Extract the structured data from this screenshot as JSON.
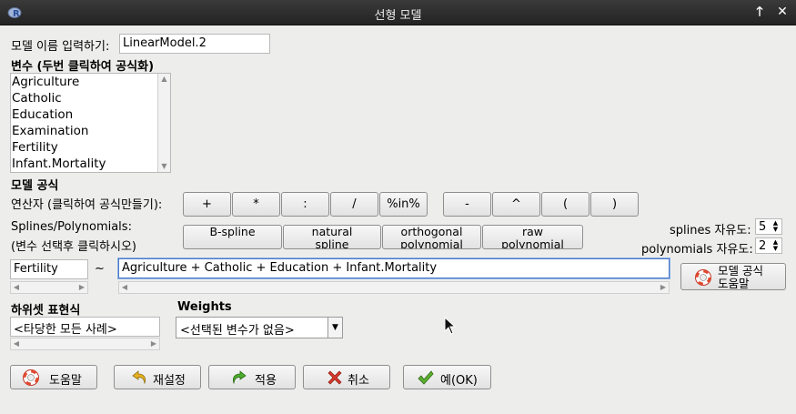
{
  "window": {
    "title": "선형 모델",
    "up_glyph": "🡑",
    "close_glyph": "✕"
  },
  "model_name": {
    "label": "모델 이름 입력하기:",
    "value": "LinearModel.2"
  },
  "variables": {
    "heading": "변수 (두번 클릭하여 공식화)",
    "items": [
      "Agriculture",
      "Catholic",
      "Education",
      "Examination",
      "Fertility",
      "Infant.Mortality"
    ]
  },
  "formula": {
    "heading": "모델 공식",
    "operators_label": "연산자 (클릭하여 공식만들기):",
    "operators": [
      "+",
      "*",
      ":",
      "/",
      "%in%",
      "-",
      "^",
      "(",
      ")"
    ],
    "splines_label_1": "Splines/Polynomials:",
    "splines_label_2": "(변수 선택후 클릭하시오)",
    "spline_buttons": [
      {
        "line1": "B-spline",
        "line2": ""
      },
      {
        "line1": "natural",
        "line2": "spline"
      },
      {
        "line1": "orthogonal",
        "line2": "polynomial"
      },
      {
        "line1": "raw",
        "line2": "polynomial"
      }
    ],
    "splines_df_label": "splines 자유도:",
    "splines_df_value": "5",
    "poly_df_label": "polynomials 자유도:",
    "poly_df_value": "2",
    "lhs": "Fertility",
    "tilde": "~",
    "rhs": "Agriculture + Catholic + Education + Infant.Mortality",
    "help_line1": "모델 공식",
    "help_line2": "도움말"
  },
  "subset": {
    "heading": "하위셋 표현식",
    "value": "<타당한 모든 사례>"
  },
  "weights": {
    "heading": "Weights",
    "selected": "<선택된 변수가 없음>"
  },
  "actions": {
    "help": "도움말",
    "reset": "재설정",
    "apply": "적용",
    "cancel": "취소",
    "ok": "예(OK)"
  }
}
